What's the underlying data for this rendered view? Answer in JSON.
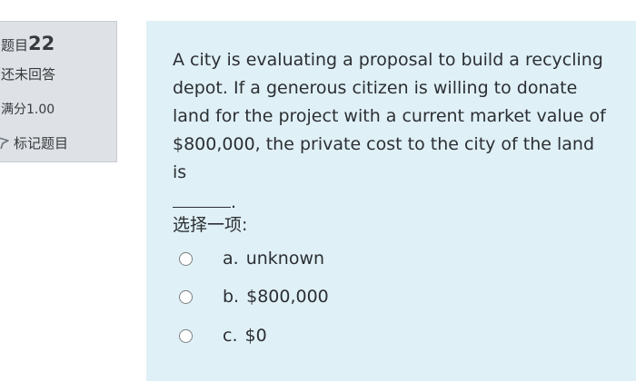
{
  "question_info": {
    "number_prefix": "题目",
    "number": "22",
    "state": "还未回答",
    "grade": "满分1.00",
    "flag_label": "标记题目"
  },
  "question": {
    "text": "A city is evaluating a proposal to build a recycling depot. If a generous citizen is willing to donate land for the project with a current market value of $800,000, the private cost to the city of the land is",
    "blank_suffix": ".",
    "prompt": "选择一项:",
    "answers": [
      {
        "letter": "a.",
        "text": "unknown",
        "selected": false
      },
      {
        "letter": "b.",
        "text": "$800,000",
        "selected": false
      },
      {
        "letter": "c.",
        "text": "$0",
        "selected": false
      }
    ]
  },
  "colors": {
    "info_background": "#dee2e6",
    "content_background": "#dff0f6"
  },
  "icons": {
    "flag": "flag-icon"
  }
}
